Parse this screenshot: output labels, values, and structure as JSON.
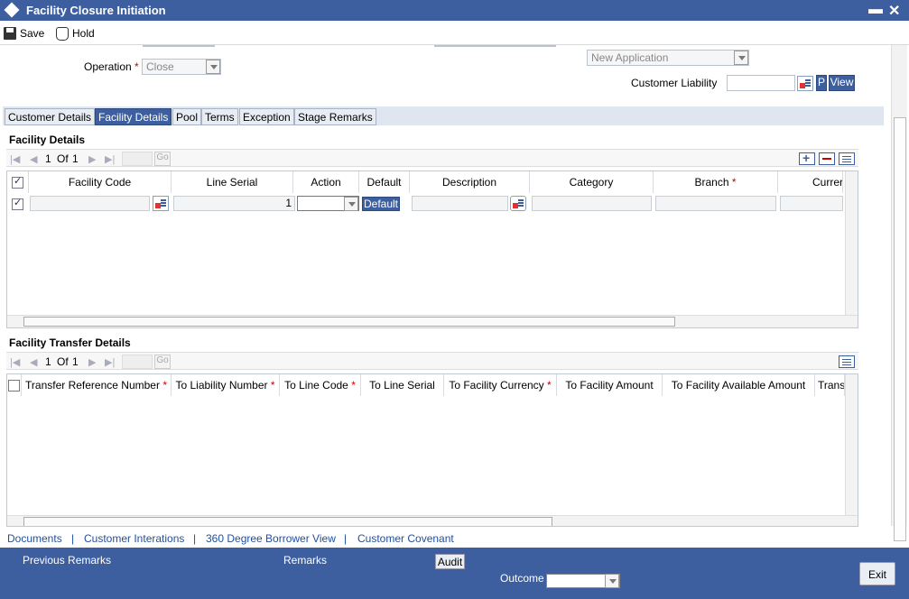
{
  "window": {
    "title": "Facility Closure Initiation",
    "minimize_glyph": "▬",
    "close_glyph": "✕"
  },
  "toolbar": {
    "save_label": "Save",
    "hold_label": "Hold"
  },
  "header": {
    "operation_label": "Operation",
    "operation_value": "Close",
    "application_status_value": "New Application",
    "customer_liability_label": "Customer Liability",
    "customer_liability_value": "",
    "p_button": "P",
    "view_button": "View"
  },
  "tabs": [
    "Customer Details",
    "Facility Details",
    "Pool",
    "Terms",
    "Exception",
    "Stage Remarks"
  ],
  "active_tab": "Facility Details",
  "facility_details": {
    "title": "Facility Details",
    "pager": {
      "page": "1",
      "of_label": "Of",
      "total": "1",
      "go": "Go"
    },
    "columns": [
      "Facility Code",
      "Line Serial",
      "Action",
      "Default",
      "Description",
      "Category",
      "Branch",
      "Currer"
    ],
    "rows": [
      {
        "facility_code": "",
        "line_serial": "1",
        "action": "",
        "default_button": "Default",
        "description": "",
        "category": "",
        "branch": "",
        "currency": ""
      }
    ]
  },
  "facility_transfer_details": {
    "title": "Facility Transfer Details",
    "pager": {
      "page": "1",
      "of_label": "Of",
      "total": "1",
      "go": "Go"
    },
    "columns": [
      "Transfer Reference Number",
      "To Liability Number",
      "To Line Code",
      "To Line Serial",
      "To Facility Currency",
      "To Facility Amount",
      "To Facility Available Amount",
      "Trans"
    ]
  },
  "links": [
    "Documents",
    "Customer Interations",
    "360 Degree Borrower View",
    "Customer Covenant"
  ],
  "footer": {
    "previous_remarks": "Previous Remarks",
    "remarks": "Remarks",
    "audit": "Audit",
    "outcome_label": "Outcome",
    "outcome_value": "",
    "exit": "Exit"
  },
  "colors": {
    "brand": "#3d5fa0",
    "required": "#cc0000",
    "link": "#1f4f9f"
  }
}
